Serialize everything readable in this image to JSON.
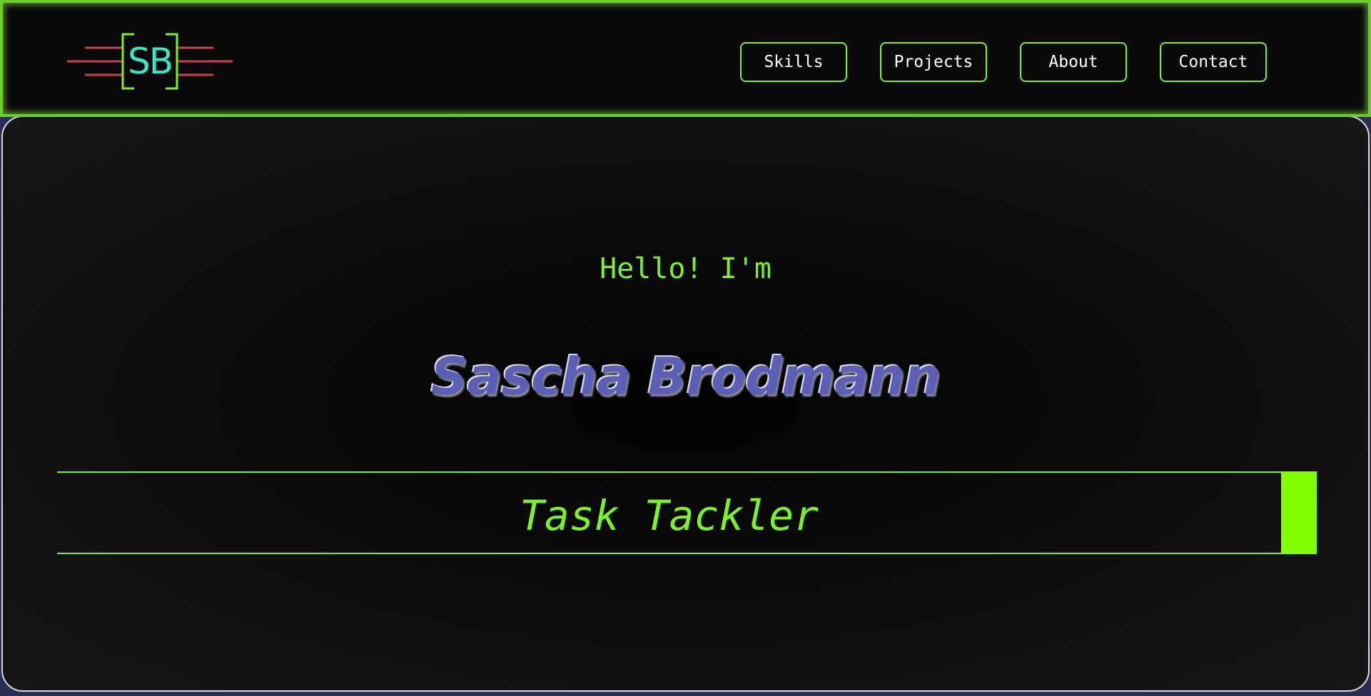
{
  "header": {
    "logo": {
      "text": "SB",
      "bracket_color": "#7cf02a",
      "line_color": "#c8424e",
      "text_color": "#39e6c9"
    },
    "nav": [
      {
        "label": "Skills"
      },
      {
        "label": "Projects"
      },
      {
        "label": "About"
      },
      {
        "label": "Contact"
      }
    ]
  },
  "hero": {
    "greeting": "Hello! I'm",
    "name": "Sascha Brodmann",
    "tagline": "Task Tackler"
  },
  "colors": {
    "accent": "#7cf02a",
    "name": "#5b5fb5",
    "background": "#0a0a0a"
  }
}
